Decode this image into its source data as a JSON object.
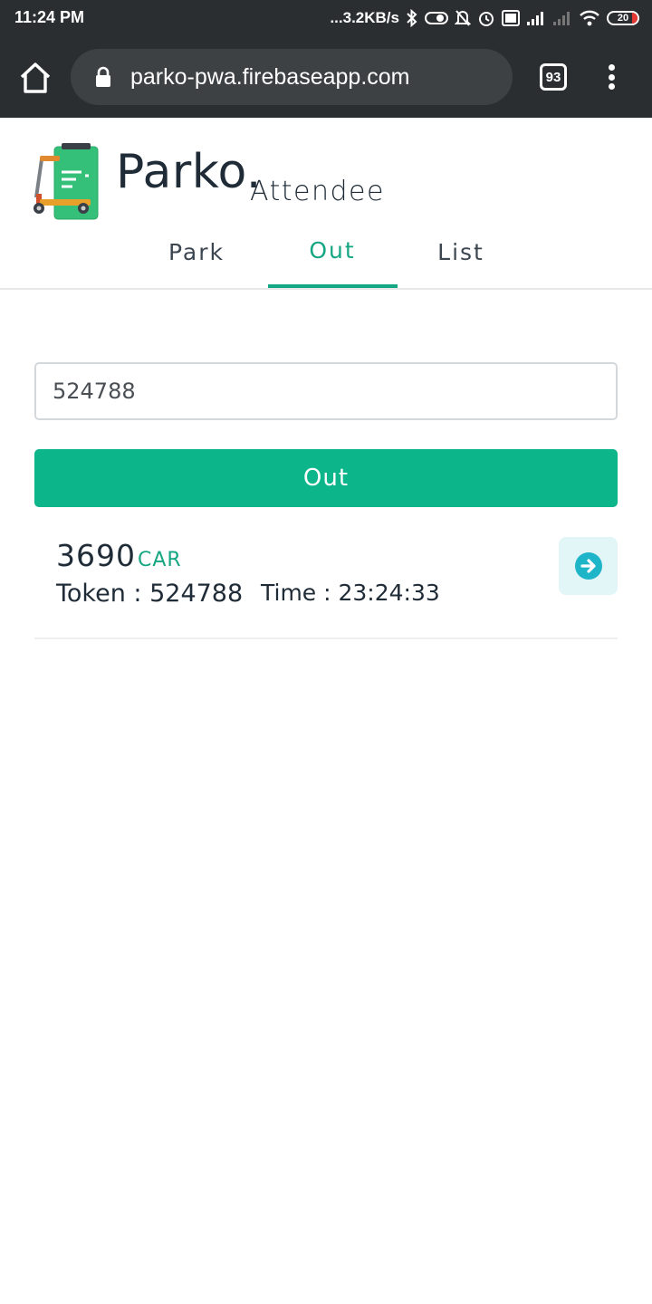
{
  "status_bar": {
    "time": "11:24 PM",
    "net_speed": "...3.2KB/s",
    "battery": "20",
    "icons": [
      "bluetooth-icon",
      "toggle-icon",
      "mute-bell-icon",
      "alarm-icon",
      "volte-icon",
      "signal-icon",
      "signal-off-icon",
      "wifi-icon",
      "battery-icon"
    ]
  },
  "browser": {
    "url": "parko-pwa.firebaseapp.com",
    "tab_count": "93"
  },
  "app": {
    "brand": "Parko.",
    "subtitle": "Attendee",
    "accent_color": "#15a683",
    "button_color": "#0db58b"
  },
  "tabs": [
    {
      "label": "Park",
      "active": false
    },
    {
      "label": "Out",
      "active": true
    },
    {
      "label": "List",
      "active": false
    }
  ],
  "form": {
    "token_value": "524788",
    "out_label": "Out"
  },
  "result": {
    "vehicle_number": "3690",
    "vehicle_type": "CAR",
    "token_text": "Token : 524788",
    "time_text": "Time : 23:24:33"
  }
}
